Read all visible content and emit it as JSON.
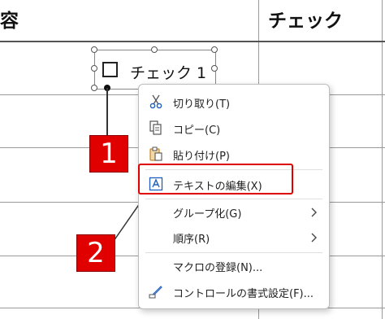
{
  "sheet": {
    "col_header_1": "容",
    "col_header_2": "チェック"
  },
  "checkbox": {
    "label": "チェック 1"
  },
  "callouts": {
    "one": "1",
    "two": "2"
  },
  "menu": {
    "items": [
      {
        "label": "切り取り(T)",
        "icon": "scissors-icon"
      },
      {
        "label": "コピー(C)",
        "icon": "copy-icon"
      },
      {
        "label": "貼り付け(P)",
        "icon": "paste-icon"
      },
      {
        "label": "テキストの編集(X)",
        "icon": "edit-text-icon"
      },
      {
        "label": "グループ化(G)",
        "icon": "",
        "submenu": true
      },
      {
        "label": "順序(R)",
        "icon": "",
        "submenu": true
      },
      {
        "label": "マクロの登録(N)...",
        "icon": ""
      },
      {
        "label": "コントロールの書式設定(F)...",
        "icon": "format-control-icon"
      }
    ]
  },
  "colors": {
    "accent_red": "#e00000",
    "icon_blue": "#1f5fbf",
    "icon_orange": "#c8832a"
  }
}
